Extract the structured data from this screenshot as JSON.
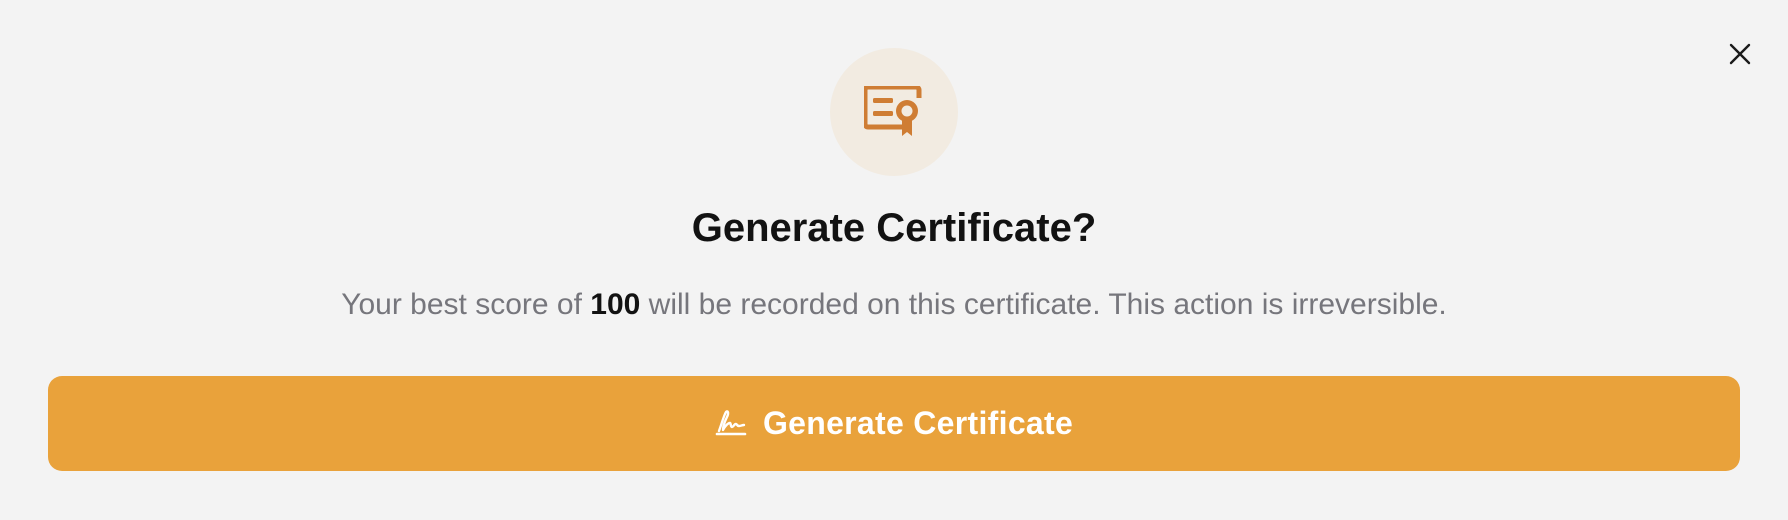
{
  "dialog": {
    "close_icon": "close-icon",
    "header_icon": "certificate-icon",
    "title": "Generate Certificate?",
    "message": {
      "before": "Your best score of ",
      "score": "100",
      "after": " will be recorded on this certificate. This action is irreversible."
    },
    "primary_button": {
      "label": "Generate Certificate",
      "icon": "signature-icon"
    }
  },
  "colors": {
    "background": "#f3f3f3",
    "accent": "#e9a23b",
    "icon_circle": "#f2ebe1",
    "icon": "#cf7d34",
    "title_text": "#121212",
    "muted_text": "#76767c"
  }
}
